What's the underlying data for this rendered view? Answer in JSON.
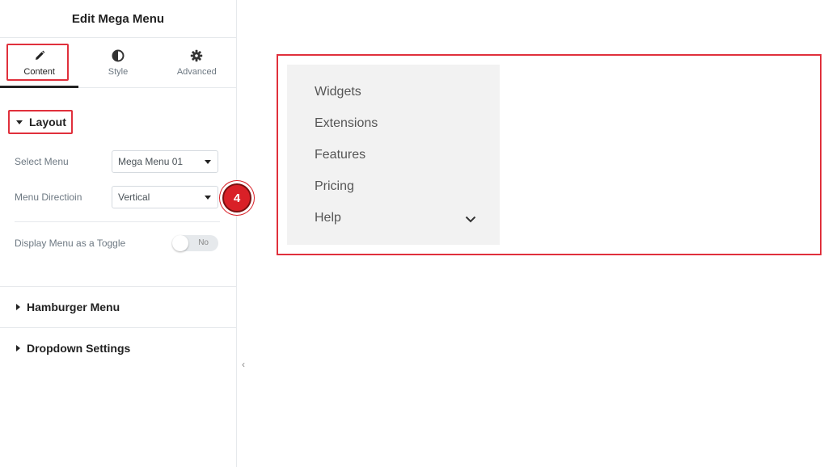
{
  "panel": {
    "title": "Edit Mega Menu",
    "tabs": [
      {
        "label": "Content",
        "icon": "pencil-icon",
        "active": true
      },
      {
        "label": "Style",
        "icon": "contrast-icon",
        "active": false
      },
      {
        "label": "Advanced",
        "icon": "gear-icon",
        "active": false
      }
    ],
    "layout_section": {
      "title": "Layout",
      "select_menu": {
        "label": "Select Menu",
        "value": "Mega Menu 01"
      },
      "menu_direction": {
        "label": "Menu Directioin",
        "value": "Vertical"
      },
      "toggle": {
        "label": "Display Menu as a Toggle",
        "state_text": "No"
      }
    },
    "sections": [
      {
        "title": "Hamburger Menu"
      },
      {
        "title": "Dropdown Settings"
      }
    ],
    "collapse_glyph": "‹"
  },
  "step_badge": "4",
  "preview": {
    "menu_items": [
      "Widgets",
      "Extensions",
      "Features",
      "Pricing",
      "Help"
    ]
  },
  "colors": {
    "highlight": "#e0303c",
    "badge": "#d92027",
    "menu_bg": "#f2f2f2"
  }
}
